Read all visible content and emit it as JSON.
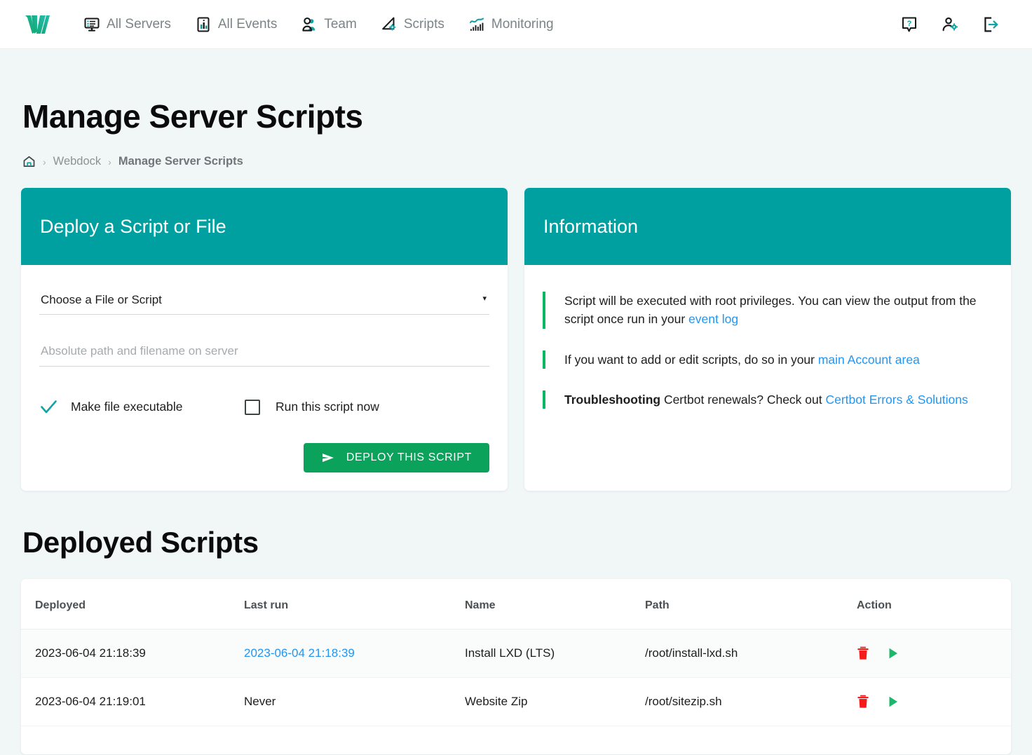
{
  "brand": {
    "logo_name": "webdock-logo",
    "teal": "#00a0a1",
    "green": "#0ba35b",
    "link_blue": "#2196f3",
    "danger_red": "#f51b1b"
  },
  "nav": {
    "items": [
      {
        "label": "All Servers",
        "icon": "monitor-list-icon"
      },
      {
        "label": "All Events",
        "icon": "bar-chart-square-icon"
      },
      {
        "label": "Team",
        "icon": "users-icon"
      },
      {
        "label": "Scripts",
        "icon": "script-gear-icon"
      },
      {
        "label": "Monitoring",
        "icon": "monitoring-chart-icon"
      }
    ],
    "right_items": [
      {
        "name": "help-icon",
        "label": "Help"
      },
      {
        "name": "user-settings-icon",
        "label": "Account settings"
      },
      {
        "name": "logout-icon",
        "label": "Log out"
      }
    ]
  },
  "header": {
    "title": "Manage Server Scripts"
  },
  "breadcrumb": {
    "home_icon": "home-icon",
    "items": [
      "Webdock",
      "Manage Server Scripts"
    ],
    "separator": "›"
  },
  "deploy_card": {
    "title": "Deploy a Script or File",
    "select": {
      "value": "Choose a File or Script",
      "caret": "▾",
      "options": [
        "Choose a File or Script"
      ]
    },
    "path_input": {
      "value": "",
      "placeholder": "Absolute path and filename on server"
    },
    "checkboxes": [
      {
        "label": "Make file executable",
        "checked": true
      },
      {
        "label": "Run this script now",
        "checked": false
      }
    ],
    "submit_label": "DEPLOY THIS SCRIPT"
  },
  "information_card": {
    "title": "Information",
    "items": [
      {
        "prefix": "",
        "text": "Script will be executed with root privileges. You can view the output from the script once run in your ",
        "link": "event log",
        "suffix": ""
      },
      {
        "prefix": "",
        "text": "If you want to add or edit scripts, do so in your ",
        "link": "main Account area",
        "suffix": ""
      },
      {
        "prefix": "Troubleshooting",
        "text": " Certbot renewals? Check out ",
        "link": "Certbot Errors & Solutions",
        "suffix": ""
      }
    ]
  },
  "deployed_scripts": {
    "title": "Deployed Scripts",
    "columns": [
      "Deployed",
      "Last run",
      "Name",
      "Path",
      "Action"
    ],
    "rows": [
      {
        "deployed": "2023-06-04 21:18:39",
        "last_run": "2023-06-04 21:18:39",
        "last_run_is_link": true,
        "name": "Install LXD (LTS)",
        "path": "/root/install-lxd.sh",
        "actions": [
          "delete-icon",
          "run-icon"
        ]
      },
      {
        "deployed": "2023-06-04 21:19:01",
        "last_run": "Never",
        "last_run_is_link": false,
        "name": "Website Zip",
        "path": "/root/sitezip.sh",
        "actions": [
          "delete-icon",
          "run-icon"
        ]
      }
    ]
  }
}
